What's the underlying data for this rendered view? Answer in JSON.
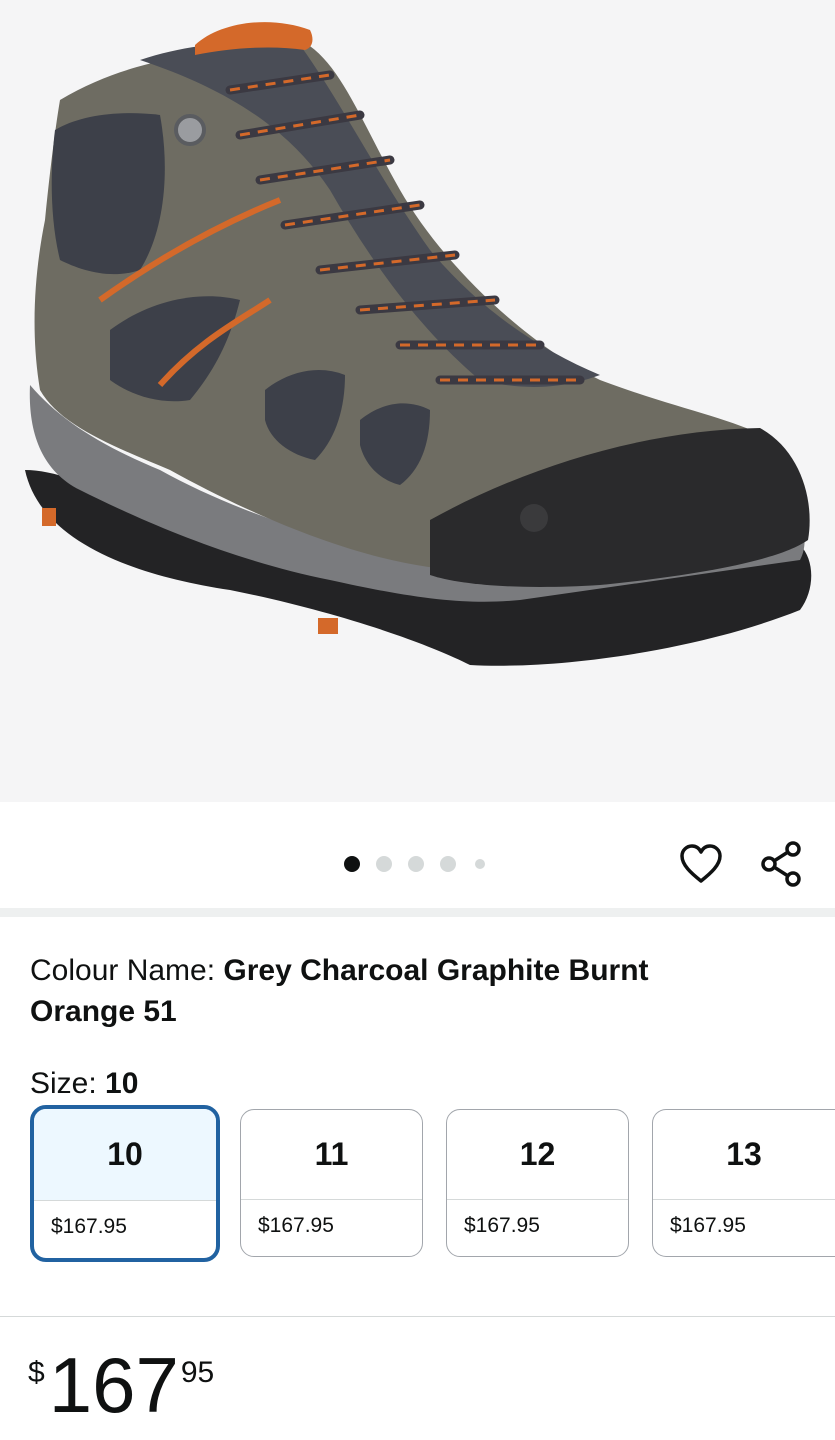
{
  "product_image": {
    "alt_icon": "hiking-boot-image"
  },
  "carousel": {
    "total": 5,
    "active_index": 0
  },
  "actions": {
    "wishlist_icon": "heart-icon",
    "share_icon": "share-icon"
  },
  "colour": {
    "label": "Colour Name: ",
    "value": "Grey Charcoal Graphite Burnt Orange 51"
  },
  "size": {
    "label": "Size: ",
    "value": "10",
    "options": [
      {
        "size": "10",
        "price": "$167.95",
        "selected": true
      },
      {
        "size": "11",
        "price": "$167.95",
        "selected": false
      },
      {
        "size": "12",
        "price": "$167.95",
        "selected": false
      },
      {
        "size": "13",
        "price": "$167.95",
        "selected": false
      }
    ]
  },
  "price": {
    "symbol": "$",
    "whole": "167",
    "fraction": "95"
  },
  "colors": {
    "selected_border": "#2162a1",
    "selected_fill": "#edf8ff",
    "boot_suede": "#6e6c62",
    "boot_orange": "#d4692a"
  }
}
